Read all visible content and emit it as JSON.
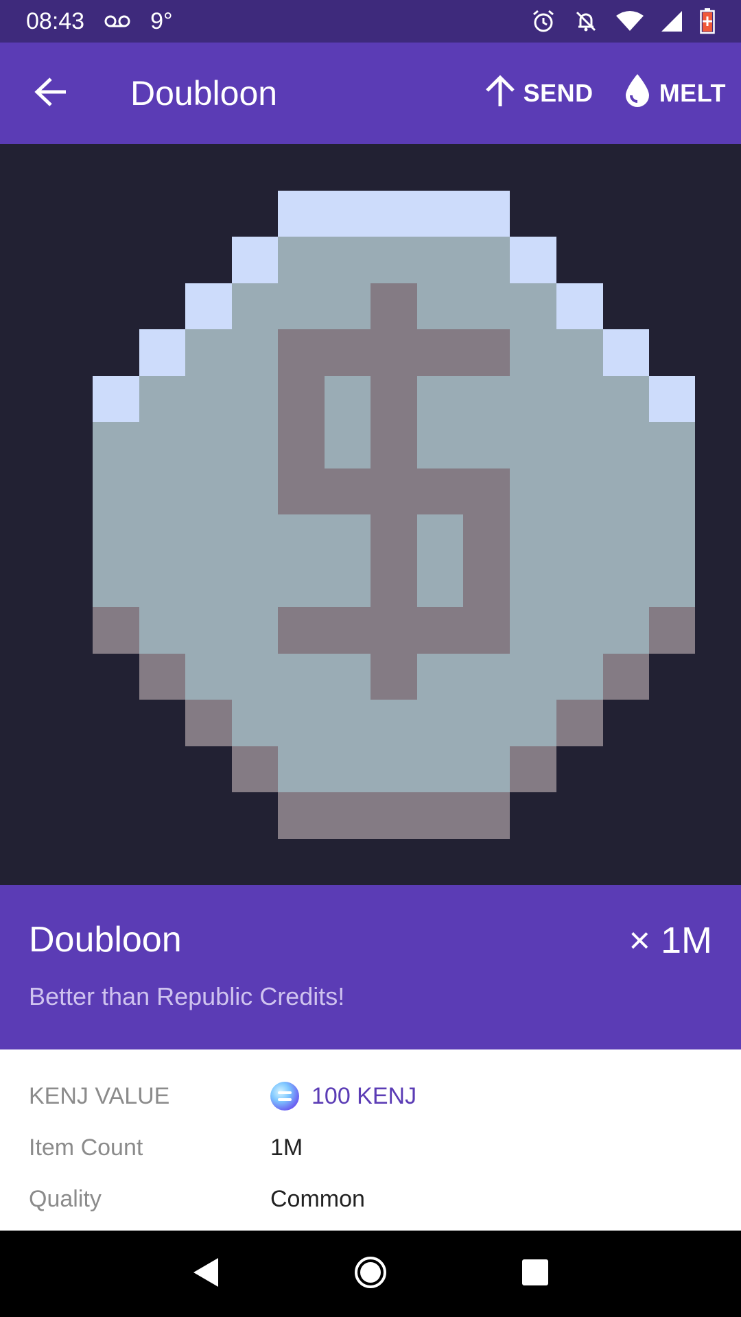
{
  "status_bar": {
    "time": "08:43",
    "voicemail_icon": "voicemail-icon",
    "temperature": "9°",
    "icons": [
      "alarm-icon",
      "notifications-off-icon",
      "wifi-icon",
      "signal-icon",
      "battery-low-icon"
    ]
  },
  "app_bar": {
    "title": "Doubloon",
    "back_icon": "arrow-left-icon",
    "actions": [
      {
        "label": "SEND",
        "icon": "arrow-up-icon"
      },
      {
        "label": "MELT",
        "icon": "drop-icon"
      }
    ]
  },
  "item": {
    "image_icon": "pixel-coin-dollar-icon",
    "name": "Doubloon",
    "quantity": "× 1M",
    "description": "Better than Republic Credits!"
  },
  "details": {
    "rows": [
      {
        "label": "KENJ VALUE",
        "value": "100 KENJ",
        "icon": "kenj-coin-icon"
      },
      {
        "label": "Item Count",
        "value": "1M"
      },
      {
        "label": "Quality",
        "value": "Common"
      }
    ]
  },
  "nav_bar": {
    "items": [
      "back-triangle-icon",
      "home-circle-icon",
      "recents-square-icon"
    ]
  },
  "colors": {
    "status_bar": "#3e2a7c",
    "primary": "#5b3cb5",
    "image_bg": "#222133",
    "coin_body": "#9aacb5",
    "coin_highlight": "#cddcfb",
    "coin_shadow": "#847b84",
    "description": "#cfc3ef",
    "label": "#8b8b8b"
  }
}
